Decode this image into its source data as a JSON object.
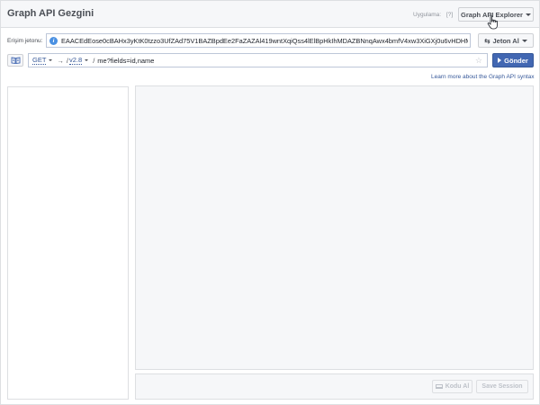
{
  "header": {
    "title": "Graph API Gezgini",
    "app_label": "Uygulama:",
    "help_link": "[?]",
    "explorer_button": "Graph API Explorer"
  },
  "token": {
    "label": "Erişim jetonu:",
    "value": "EAACEdEose0cBAHx3yKtK0tzzo3UfZAd75V1BAZBpdEe2FaZAZAl419wntXqiQss4lElBpHkIhMDAZBNnqAwx4bmfV4xw3XiGXj0u6vHDHMo",
    "get_token_button": "Jeton Al"
  },
  "query": {
    "method": "GET",
    "arrow": "→",
    "slash_prefix": "/",
    "version": "v2.8",
    "slash_suffix": "/",
    "path": "me?fields=id,name",
    "send_button": "Gönder",
    "syntax_link": "Learn more about the Graph API syntax"
  },
  "footer": {
    "code_button": "Kodu Al",
    "save_session_button": "Save Session"
  },
  "colors": {
    "accent": "#4267b2",
    "link": "#365899",
    "panel_bg": "#f6f7f9",
    "border": "#dddfe2"
  }
}
